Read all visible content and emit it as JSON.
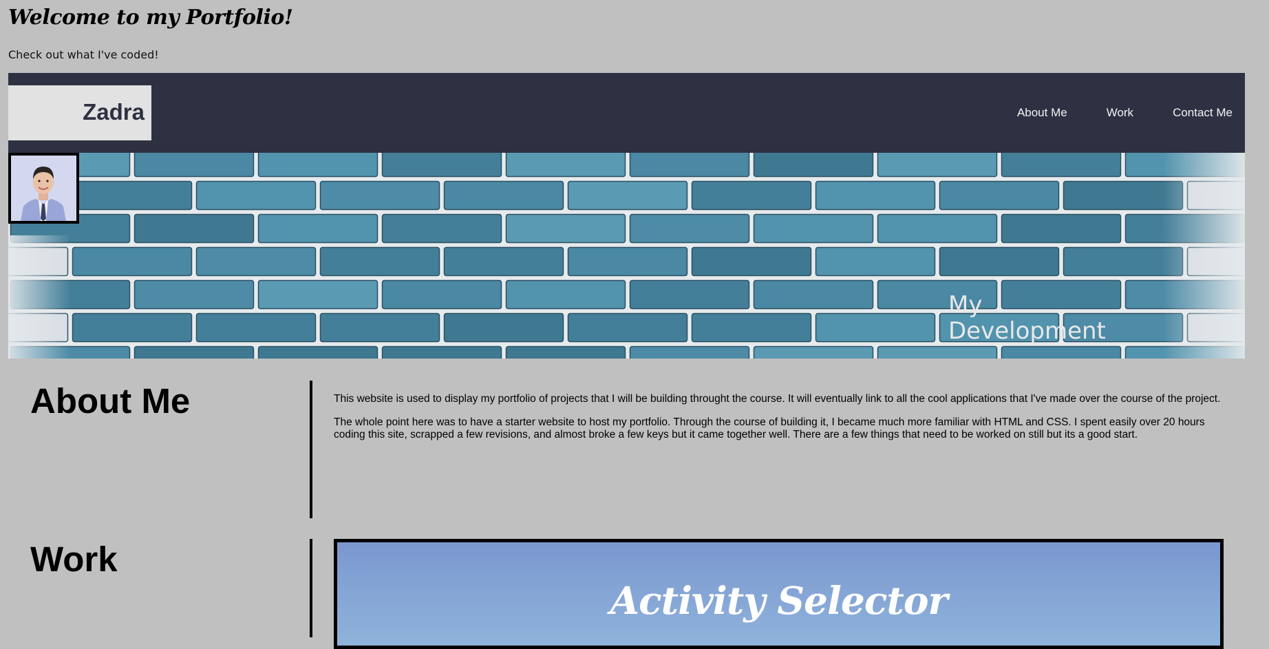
{
  "page": {
    "heading": "Welcome to my Portfolio!",
    "subheading": "Check out what I've coded!"
  },
  "header": {
    "brand": "Zadra",
    "nav": [
      {
        "label": "About Me"
      },
      {
        "label": "Work"
      },
      {
        "label": "Contact Me"
      }
    ]
  },
  "hero": {
    "caption_line1": "My",
    "caption_line2": "Development"
  },
  "about": {
    "title": "About Me",
    "paragraphs": [
      "This website is used to display my portfolio of projects that I will be building throught the course. It will eventually link to all the cool applications that I've made over the course of the project.",
      "The whole point here was to have a starter website to host my portfolio. Through the course of building it, I became much more familiar with HTML and CSS. I spent easily over 20 hours coding this site, scrapped a few revisions, and almost broke a few keys but it came together well. There are a few things that need to be worked on still but its a good start."
    ]
  },
  "work": {
    "title": "Work",
    "project_title": "Activity Selector"
  },
  "colors": {
    "page_background": "#c0c0c0",
    "header_background": "#2e3142",
    "brand_box": "#e2e2e2",
    "brick_blue": "#4c8aa5",
    "mortar": "#dfe7ec"
  }
}
